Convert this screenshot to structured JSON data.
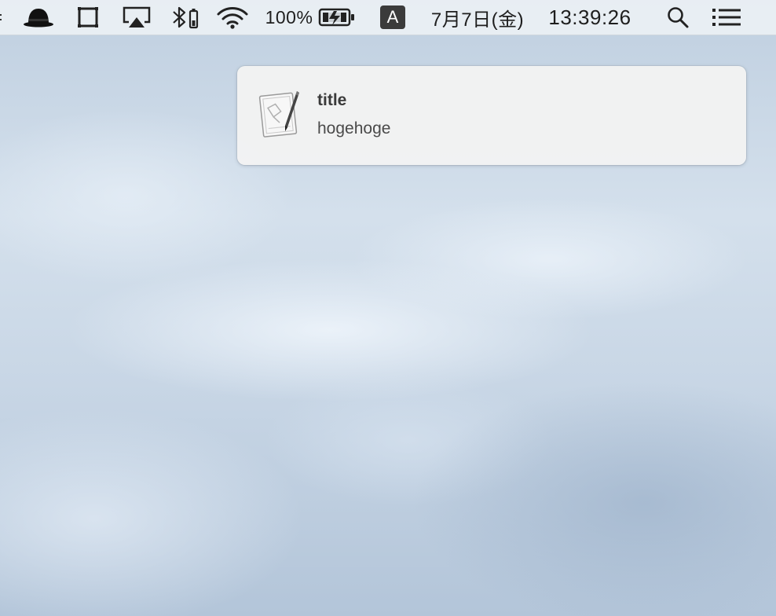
{
  "menubar": {
    "items": [
      {
        "name": "bowler-hat-icon"
      },
      {
        "name": "window-icon"
      },
      {
        "name": "airplay-icon"
      },
      {
        "name": "bluetooth-icon"
      },
      {
        "name": "wifi-icon"
      }
    ],
    "battery_percent": "100%",
    "battery_icon": "battery-charging-icon",
    "input_source": "A",
    "date": "7月7日(金)",
    "time": "13:39:26",
    "search_icon": "spotlight-search-icon",
    "notification_center_icon": "notification-center-icon"
  },
  "notification": {
    "app_icon": "script-editor-icon",
    "title": "title",
    "body": "hogehoge"
  },
  "colors": {
    "menubar_bg": "#ecf0f4",
    "notification_bg": "#f2f2f2",
    "input_badge_bg": "#3b3b3b"
  }
}
